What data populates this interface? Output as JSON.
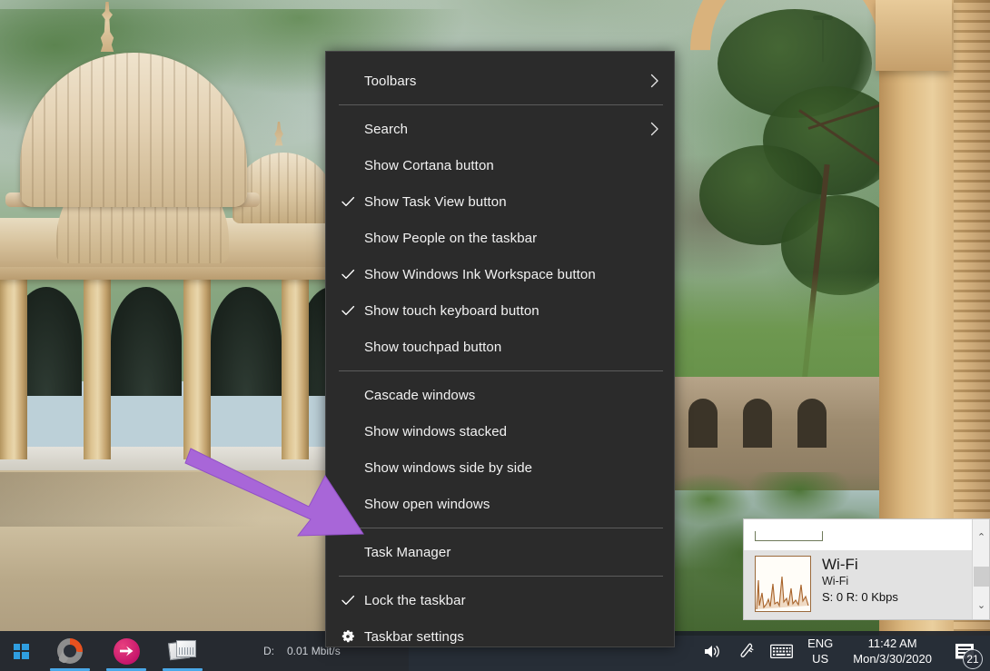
{
  "window": {
    "title": "Windows 10 Desktop — Taskbar context menu",
    "wallpaper_description": "Sandstone domed cenotaphs with green hills and carved pillar"
  },
  "context_menu": {
    "name": "taskbar-context-menu",
    "background_color": "#2b2b2b",
    "text_color": "#f2f2f2",
    "groups": [
      {
        "items": [
          {
            "label": "Toolbars",
            "checked": false,
            "submenu": true,
            "icon": "chevron-right-icon"
          }
        ]
      },
      {
        "items": [
          {
            "label": "Search",
            "checked": false,
            "submenu": true,
            "icon": "chevron-right-icon"
          },
          {
            "label": "Show Cortana button",
            "checked": false,
            "submenu": false
          },
          {
            "label": "Show Task View button",
            "checked": true,
            "submenu": false,
            "icon": "check-icon"
          },
          {
            "label": "Show People on the taskbar",
            "checked": false,
            "submenu": false
          },
          {
            "label": "Show Windows Ink Workspace button",
            "checked": true,
            "submenu": false,
            "icon": "check-icon"
          },
          {
            "label": "Show touch keyboard button",
            "checked": true,
            "submenu": false,
            "icon": "check-icon"
          },
          {
            "label": "Show touchpad button",
            "checked": false,
            "submenu": false
          }
        ]
      },
      {
        "items": [
          {
            "label": "Cascade windows",
            "checked": false,
            "submenu": false
          },
          {
            "label": "Show windows stacked",
            "checked": false,
            "submenu": false
          },
          {
            "label": "Show windows side by side",
            "checked": false,
            "submenu": false
          },
          {
            "label": "Show open windows",
            "checked": false,
            "submenu": false
          }
        ]
      },
      {
        "items": [
          {
            "label": "Task Manager",
            "checked": false,
            "submenu": false
          }
        ]
      },
      {
        "items": [
          {
            "label": "Lock the taskbar",
            "checked": true,
            "submenu": false,
            "icon": "check-icon"
          },
          {
            "label": "Taskbar settings",
            "checked": false,
            "submenu": false,
            "icon": "gear-icon"
          }
        ]
      }
    ]
  },
  "annotation": {
    "name": "purple-arrow",
    "color": "#a05fd0",
    "points_to": "Task Manager"
  },
  "network_popup": {
    "name": "wifi-network-popup",
    "title": "Wi-Fi",
    "subtitle": "Wi-Fi",
    "rate": "S: 0 R: 0 Kbps",
    "scroll_up_glyph": "⌃",
    "scroll_down_glyph": "⌄"
  },
  "taskbar": {
    "background_color": "#1c212a",
    "start_button": "start-button",
    "apps": [
      {
        "name": "nero",
        "label": "Nero",
        "active": true
      },
      {
        "name": "pink-app",
        "label": "Pink app",
        "active": true
      },
      {
        "name": "photos",
        "label": "Photos",
        "active": true
      }
    ],
    "network_meter": {
      "down_label": "D:",
      "down_value": "0.01 Mbit/s"
    },
    "tray": {
      "volume_icon": "speaker-icon",
      "pen_icon": "pen-workspace-icon",
      "keyboard_icon": "touch-keyboard-icon",
      "language_line1": "ENG",
      "language_line2": "US",
      "clock_time": "11:42 AM",
      "clock_date": "Mon/3/30/2020",
      "notification_count": "21"
    }
  }
}
